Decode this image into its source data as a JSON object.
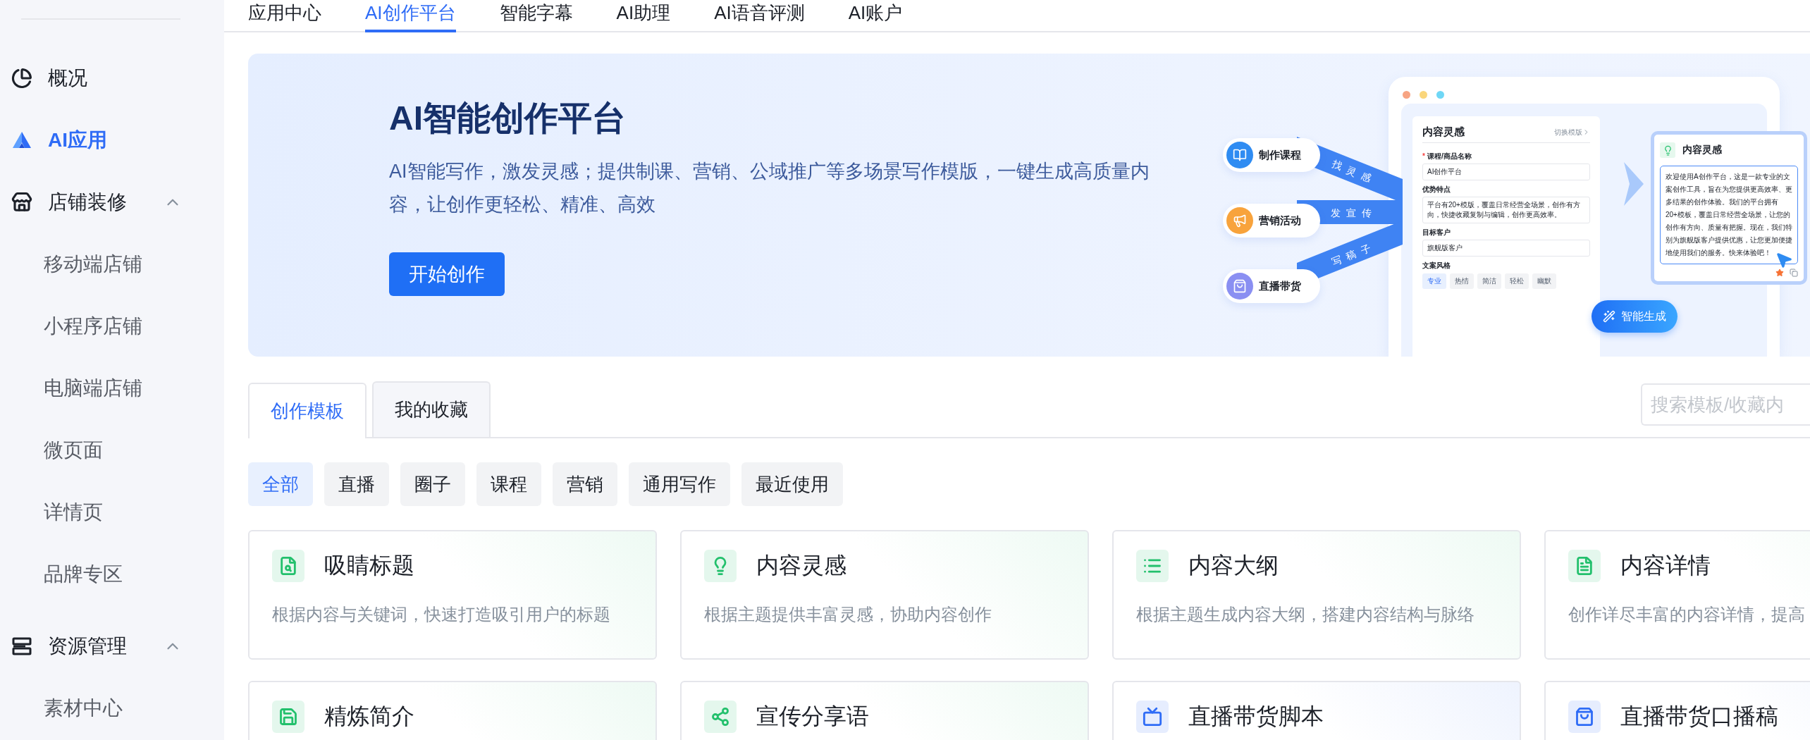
{
  "top_nav": {
    "tabs": [
      {
        "label": "应用中心",
        "selected": false
      },
      {
        "label": "AI创作平台",
        "selected": true
      },
      {
        "label": "智能字幕",
        "selected": false
      },
      {
        "label": "AI助理",
        "selected": false
      },
      {
        "label": "AI语音评测",
        "selected": false
      },
      {
        "label": "AI账户",
        "selected": false
      }
    ]
  },
  "sidebar": {
    "items": [
      {
        "kind": "link",
        "label": "概况",
        "selected": false
      },
      {
        "kind": "link",
        "label": "AI应用",
        "selected": true
      },
      {
        "kind": "group",
        "label": "店铺装修",
        "expanded": true,
        "children": [
          {
            "label": "移动端店铺",
            "selected": false
          },
          {
            "label": "小程序店铺",
            "selected": false
          },
          {
            "label": "电脑端店铺",
            "selected": false
          },
          {
            "label": "微页面",
            "selected": false
          },
          {
            "label": "详情页",
            "selected": false
          },
          {
            "label": "品牌专区",
            "selected": false
          }
        ]
      },
      {
        "kind": "group",
        "label": "资源管理",
        "expanded": true,
        "children": [
          {
            "label": "素材中心",
            "selected": false
          }
        ]
      }
    ]
  },
  "banner": {
    "title": "AI智能创作平台",
    "description": "AI智能写作，激发灵感；提供制课、营销、公域推广等多场景写作模版，一键生成高质量内容，让创作更轻松、精准、高效",
    "button": "开始创作",
    "illustration": {
      "channels": [
        {
          "label": "制作课程",
          "color": "#2f8cf2"
        },
        {
          "label": "营销活动",
          "color": "#f8a33c"
        },
        {
          "label": "直播带货",
          "color": "#8a8ff2"
        }
      ],
      "flow_labels": [
        "找灵感",
        "发宣传",
        "写稿子"
      ],
      "form": {
        "title": "内容灵感",
        "switch_link": "切换模版",
        "fields": [
          {
            "label": "课程/商品名称",
            "marker": "*",
            "value": "AI创作平台"
          },
          {
            "label": "优势特点",
            "value": "平台有20+模版，覆盖日常经营全场景，创作有方向，快捷收藏复制与编辑，创作更高效率。"
          },
          {
            "label": "目标客户",
            "value": "旗舰版客户"
          }
        ],
        "style_label": "文案风格",
        "styles": [
          {
            "label": "专业",
            "selected": true
          },
          {
            "label": "热情",
            "selected": false
          },
          {
            "label": "简洁",
            "selected": false
          },
          {
            "label": "轻松",
            "selected": false
          },
          {
            "label": "幽默",
            "selected": false
          }
        ]
      },
      "result": {
        "title": "内容灵感",
        "text": "欢迎使用A创作平台，这是一款专业的文案创作工具，旨在为您提供更高效率、更多结果的创作体验。我们的平台拥有20+模板，覆盖日常经营全场景，让您的创作有方向、质量有把握。现在，我们特别为旗舰版客户提供优惠，让您更加便捷地使用我们的服务。快来体验吧！"
      },
      "generate_button": "智能生成"
    }
  },
  "template_tabs": [
    {
      "label": "创作模板",
      "selected": true
    },
    {
      "label": "我的收藏",
      "selected": false
    }
  ],
  "search": {
    "placeholder": "搜索模板/收藏内"
  },
  "filters": [
    {
      "label": "全部",
      "selected": true
    },
    {
      "label": "直播",
      "selected": false
    },
    {
      "label": "圈子",
      "selected": false
    },
    {
      "label": "课程",
      "selected": false
    },
    {
      "label": "营销",
      "selected": false
    },
    {
      "label": "通用写作",
      "selected": false
    },
    {
      "label": "最近使用",
      "selected": false
    }
  ],
  "cards": [
    {
      "title": "吸睛标题",
      "description": "根据内容与关键词，快速打造吸引用户的标题",
      "color": "#22c06c"
    },
    {
      "title": "内容灵感",
      "description": "根据主题提供丰富灵感，协助内容创作",
      "color": "#22c06c"
    },
    {
      "title": "内容大纲",
      "description": "根据主题生成内容大纲，搭建内容结构与脉络",
      "color": "#22c06c"
    },
    {
      "title": "内容详情",
      "description": "创作详尽丰富的内容详情，提高",
      "color": "#22c06c"
    },
    {
      "title": "精炼简介",
      "color": "#22c06c"
    },
    {
      "title": "宣传分享语",
      "color": "#22c06c"
    },
    {
      "title": "直播带货脚本",
      "color": "#2f6cf6"
    },
    {
      "title": "直播带货口播稿",
      "color": "#2f6cf6"
    }
  ]
}
